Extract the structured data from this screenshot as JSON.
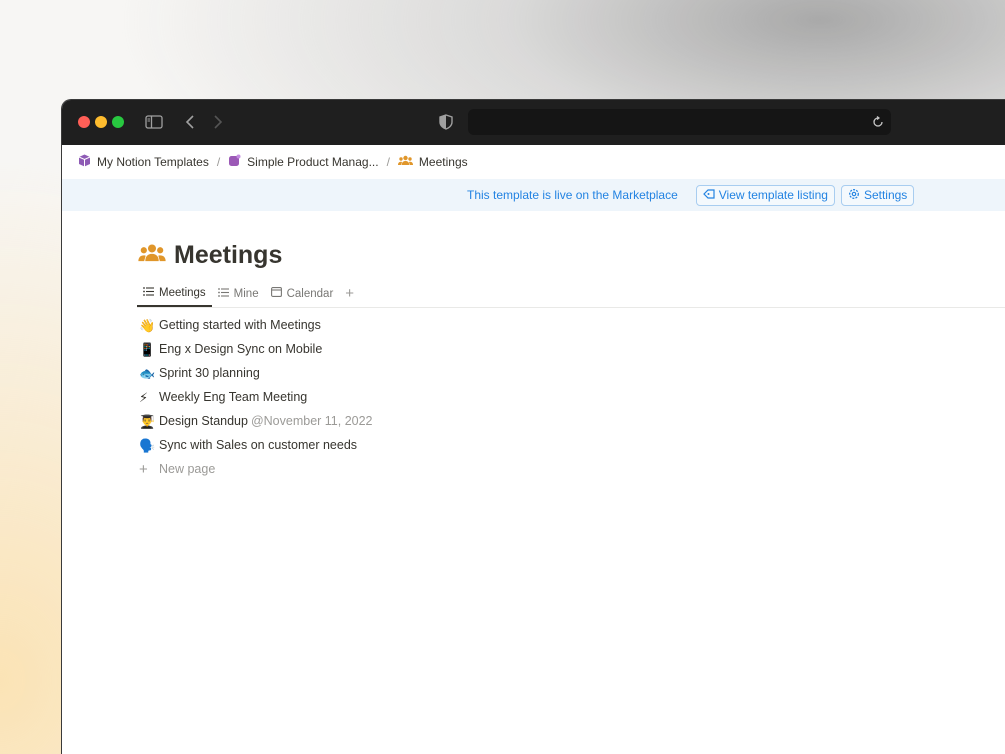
{
  "breadcrumb": [
    {
      "icon": "notion-cube-icon",
      "label": "My Notion Templates"
    },
    {
      "icon": "purple-app-icon",
      "label": "Simple Product Manag..."
    },
    {
      "icon": "people-icon",
      "label": "Meetings"
    }
  ],
  "breadcrumb_separator": "/",
  "banner": {
    "text": "This template is live on the Marketplace",
    "listing_label": "View template listing",
    "settings_label": "Settings"
  },
  "page": {
    "title": "Meetings",
    "icon": "people-icon",
    "icon_color": "#e0962a"
  },
  "tabs": [
    {
      "label": "Meetings",
      "icon": "list-icon",
      "active": true
    },
    {
      "label": "Mine",
      "icon": "list-icon",
      "active": false
    },
    {
      "label": "Calendar",
      "icon": "calendar-icon",
      "active": false
    }
  ],
  "tab_add": "+",
  "items": [
    {
      "emoji": "👋",
      "title": "Getting started with Meetings",
      "date": ""
    },
    {
      "emoji": "📱",
      "title": "Eng x Design Sync on Mobile",
      "date": ""
    },
    {
      "emoji": "🐟",
      "title": "Sprint 30 planning",
      "date": ""
    },
    {
      "emoji": "⚡",
      "title": "Weekly Eng Team Meeting",
      "date": ""
    },
    {
      "emoji": "👨‍🎓",
      "title": "Design Standup",
      "date": "@November 11, 2022"
    },
    {
      "emoji": "🗣️",
      "title": "Sync with Sales on customer needs",
      "date": ""
    }
  ],
  "new_page": {
    "icon": "+",
    "label": "New page"
  },
  "colors": {
    "accent": "#2383e2",
    "banner_bg": "#eef5fb",
    "titlebar": "#1f1f1f",
    "text": "#37352f"
  }
}
